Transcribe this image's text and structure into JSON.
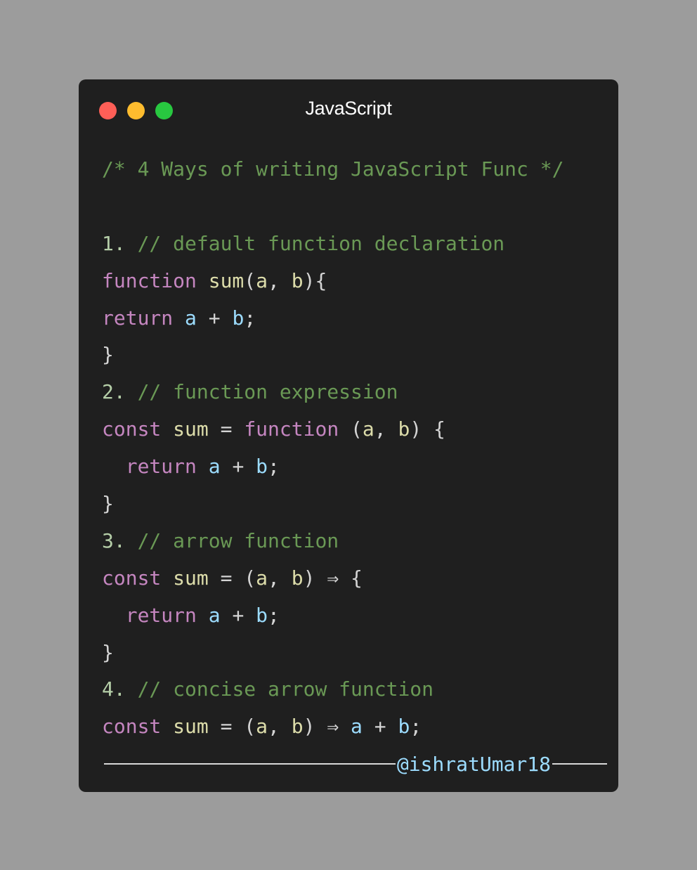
{
  "window": {
    "title": "JavaScript",
    "background": "#1f1f1f",
    "traffic_lights": [
      {
        "name": "close",
        "color": "#ff5f57"
      },
      {
        "name": "minimize",
        "color": "#febc2e"
      },
      {
        "name": "maximize",
        "color": "#28c840"
      }
    ]
  },
  "page_background": "#9c9c9c",
  "colors": {
    "comment": "#6a9955",
    "number": "#b5cea8",
    "keyword": "#c586c0",
    "function": "#dcdcaa",
    "variable": "#9cdcfe",
    "plain": "#d4d4d4"
  },
  "code": {
    "lines": [
      [
        {
          "t": "comment",
          "v": "/* 4 Ways of writing JavaScript Func */"
        }
      ],
      [],
      [
        {
          "t": "number",
          "v": "1. "
        },
        {
          "t": "comment",
          "v": "// default function declaration"
        }
      ],
      [
        {
          "t": "keyword",
          "v": "function "
        },
        {
          "t": "function",
          "v": "sum"
        },
        {
          "t": "plain",
          "v": "("
        },
        {
          "t": "function",
          "v": "a"
        },
        {
          "t": "plain",
          "v": ", "
        },
        {
          "t": "function",
          "v": "b"
        },
        {
          "t": "plain",
          "v": "){"
        }
      ],
      [
        {
          "t": "keyword",
          "v": "return "
        },
        {
          "t": "variable",
          "v": "a"
        },
        {
          "t": "plain",
          "v": " + "
        },
        {
          "t": "variable",
          "v": "b"
        },
        {
          "t": "plain",
          "v": ";"
        }
      ],
      [
        {
          "t": "plain",
          "v": "}"
        }
      ],
      [
        {
          "t": "number",
          "v": "2. "
        },
        {
          "t": "comment",
          "v": "// function expression"
        }
      ],
      [
        {
          "t": "keyword",
          "v": "const "
        },
        {
          "t": "function",
          "v": "sum"
        },
        {
          "t": "plain",
          "v": " = "
        },
        {
          "t": "keyword",
          "v": "function "
        },
        {
          "t": "plain",
          "v": "("
        },
        {
          "t": "function",
          "v": "a"
        },
        {
          "t": "plain",
          "v": ", "
        },
        {
          "t": "function",
          "v": "b"
        },
        {
          "t": "plain",
          "v": ") {"
        }
      ],
      [
        {
          "t": "plain",
          "v": "  "
        },
        {
          "t": "keyword",
          "v": "return "
        },
        {
          "t": "variable",
          "v": "a"
        },
        {
          "t": "plain",
          "v": " + "
        },
        {
          "t": "variable",
          "v": "b"
        },
        {
          "t": "plain",
          "v": ";"
        }
      ],
      [
        {
          "t": "plain",
          "v": "}"
        }
      ],
      [
        {
          "t": "number",
          "v": "3. "
        },
        {
          "t": "comment",
          "v": "// arrow function"
        }
      ],
      [
        {
          "t": "keyword",
          "v": "const "
        },
        {
          "t": "function",
          "v": "sum"
        },
        {
          "t": "plain",
          "v": " = ("
        },
        {
          "t": "function",
          "v": "a"
        },
        {
          "t": "plain",
          "v": ", "
        },
        {
          "t": "function",
          "v": "b"
        },
        {
          "t": "plain",
          "v": ") ⇒ {"
        }
      ],
      [
        {
          "t": "plain",
          "v": "  "
        },
        {
          "t": "keyword",
          "v": "return "
        },
        {
          "t": "variable",
          "v": "a"
        },
        {
          "t": "plain",
          "v": " + "
        },
        {
          "t": "variable",
          "v": "b"
        },
        {
          "t": "plain",
          "v": ";"
        }
      ],
      [
        {
          "t": "plain",
          "v": "}"
        }
      ],
      [
        {
          "t": "number",
          "v": "4. "
        },
        {
          "t": "comment",
          "v": "// concise arrow function"
        }
      ],
      [
        {
          "t": "keyword",
          "v": "const "
        },
        {
          "t": "function",
          "v": "sum"
        },
        {
          "t": "plain",
          "v": " = ("
        },
        {
          "t": "function",
          "v": "a"
        },
        {
          "t": "plain",
          "v": ", "
        },
        {
          "t": "function",
          "v": "b"
        },
        {
          "t": "plain",
          "v": ") ⇒ "
        },
        {
          "t": "variable",
          "v": "a"
        },
        {
          "t": "plain",
          "v": " + "
        },
        {
          "t": "variable",
          "v": "b"
        },
        {
          "t": "plain",
          "v": ";"
        }
      ]
    ]
  },
  "signature": {
    "handle": "@ishratUmar18",
    "rule_color": "#d8d8d8"
  }
}
